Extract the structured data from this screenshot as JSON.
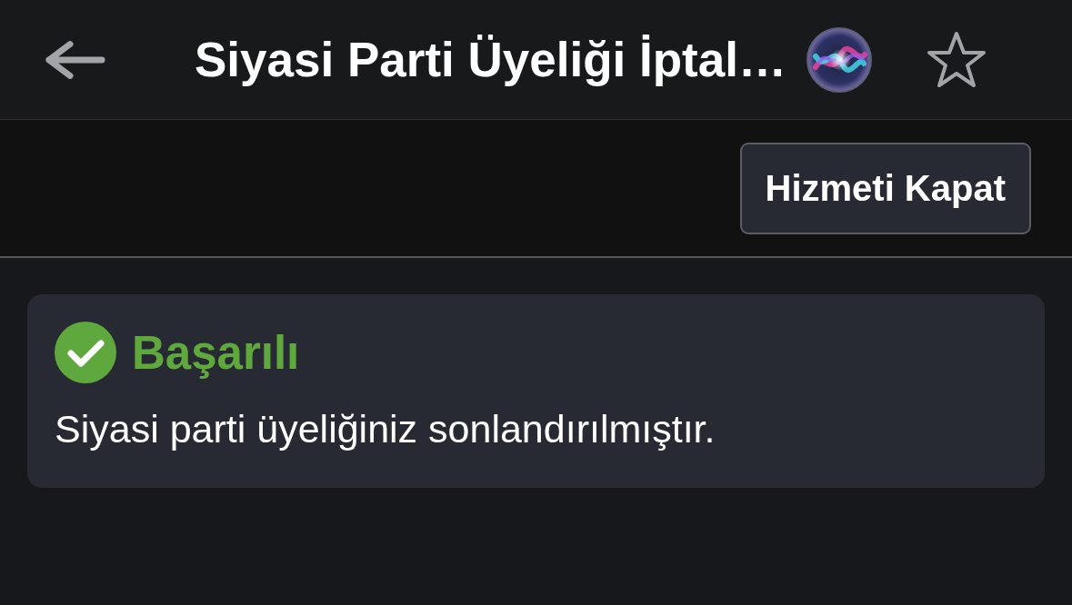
{
  "header": {
    "title": "Siyasi Parti Üyeliği İptal…",
    "favorited": false
  },
  "toolbar": {
    "buttons": [
      {
        "label": "Hizmeti Kapat"
      }
    ]
  },
  "alert": {
    "kind": "success",
    "title": "Başarılı",
    "message": "Siyasi parti üyeliğiniz sonlandırılmıştır."
  }
}
